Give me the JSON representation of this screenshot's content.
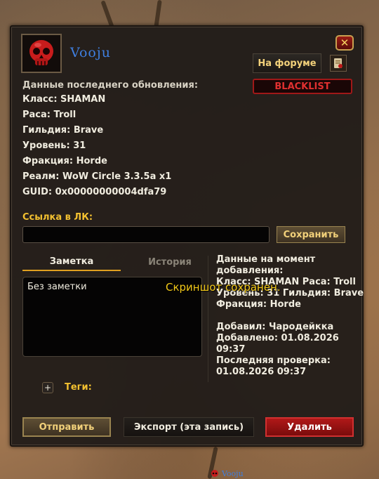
{
  "header": {
    "name": "Vooju",
    "forum_label": "На форуме",
    "blacklist_label": "BLACKLIST",
    "close_icon": "close-x-icon"
  },
  "info": {
    "heading": "Данные последнего обновления:",
    "lines": [
      "Класс: SHAMAN",
      "Раса: Troll",
      "Гильдия: Brave",
      "Уровень: 31",
      "Фракция: Horde",
      "Реалм: WoW Circle 3.3.5a x1",
      "GUID: 0x00000000004dfa79"
    ]
  },
  "lk": {
    "label": "Ссылка в ЛК:",
    "value": "",
    "save_label": "Сохранить"
  },
  "tabs": {
    "note": "Заметка",
    "history": "История"
  },
  "note": {
    "text": "Без заметки"
  },
  "added": {
    "title_line1": "Данные на момент",
    "title_line2": "добавления:",
    "line_class_race": "Класс: SHAMAN  Раса: Troll",
    "line_level_guild": "Уровень: 31  Гильдия: Brave",
    "line_faction": "Фракция: Horde",
    "added_by": "Добавил: Чародейкка",
    "added_on_line1": "Добавлено: 01.08.2026",
    "added_on_line2": "09:37",
    "checked_line1": "Последняя проверка:",
    "checked_line2": "01.08.2026 09:37"
  },
  "toast": "Скриншот сохранен.",
  "tags": {
    "plus": "+",
    "label": "Теги:"
  },
  "actions": {
    "send": "Отправить",
    "export": "Экспорт (эта запись)",
    "delete": "Удалить"
  },
  "bottom_strip": {
    "name": "Vooju"
  },
  "colors": {
    "accent_gold": "#f2c030",
    "name_blue": "#3f7fe0",
    "danger_red": "#d03030"
  }
}
